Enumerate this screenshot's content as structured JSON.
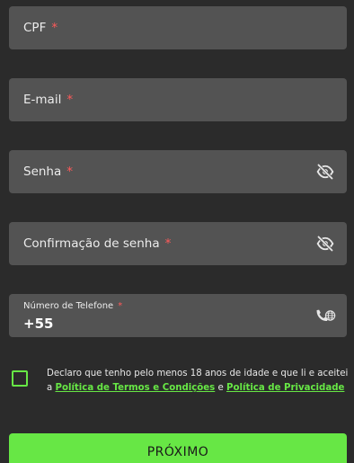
{
  "fields": {
    "cpf": {
      "label": "CPF",
      "required_mark": "*"
    },
    "email": {
      "label": "E-mail",
      "required_mark": "*"
    },
    "password": {
      "label": "Senha",
      "required_mark": "*",
      "icon": "eye-off-icon"
    },
    "password_confirm": {
      "label": "Confirmação de senha",
      "required_mark": "*",
      "icon": "eye-off-icon"
    },
    "phone": {
      "label": "Número de Telefone",
      "required_mark": "*",
      "prefix": "+55",
      "icon": "phone-globe-icon"
    }
  },
  "consent": {
    "checked": false,
    "text_start": "Declaro que tenho pelo menos 18 anos de idade e que li e aceitei a ",
    "terms_link": "Política de Termos e Condições",
    "joiner": " e ",
    "privacy_link": "Política de Privacidade"
  },
  "next_button": {
    "label": "PRÓXIMO"
  },
  "colors": {
    "background": "#2b2b2b",
    "field": "#535353",
    "accent": "#67e745",
    "required": "#ff5a5a"
  }
}
